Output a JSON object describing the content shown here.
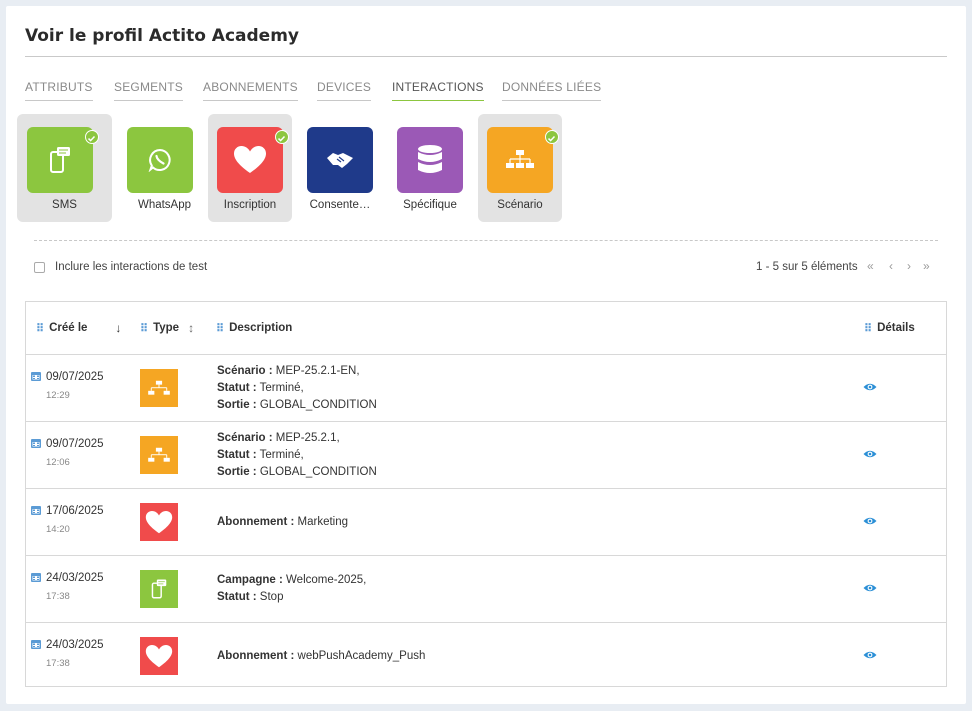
{
  "page": {
    "title": "Voir le profil Actito Academy"
  },
  "tabs": [
    {
      "label": "ATTRIBUTS",
      "active": false
    },
    {
      "label": "SEGMENTS",
      "active": false
    },
    {
      "label": "ABONNEMENTS",
      "active": false
    },
    {
      "label": "DEVICES",
      "active": false
    },
    {
      "label": "INTERACTIONS",
      "active": true
    },
    {
      "label": "DONNÉES LIÉES",
      "active": false
    }
  ],
  "interaction_types": [
    {
      "label": "SMS",
      "color": "#8cc63f",
      "icon": "phone-message-icon",
      "selected": true
    },
    {
      "label": "WhatsApp",
      "color": "#8cc63f",
      "icon": "whatsapp-icon",
      "selected": false
    },
    {
      "label": "Inscription",
      "color": "#f04b4b",
      "icon": "heart-icon",
      "selected": true
    },
    {
      "label": "Consente…",
      "color": "#1f3a8a",
      "icon": "handshake-icon",
      "selected": false
    },
    {
      "label": "Spécifique",
      "color": "#9b59b6",
      "icon": "database-icon",
      "selected": false
    },
    {
      "label": "Scénario",
      "color": "#f5a623",
      "icon": "scenario-flow-icon",
      "selected": true
    }
  ],
  "filters": {
    "include_test_label": "Inclure les interactions de test"
  },
  "pagination": {
    "summary": "1 - 5 sur 5 éléments"
  },
  "table": {
    "headers": {
      "created": "Créé le",
      "type": "Type",
      "description": "Description",
      "details": "Détails"
    },
    "rows": [
      {
        "date": "09/07/2025",
        "time": "12:29",
        "type_icon": "scenario-flow-icon",
        "type_color": "#f5a623",
        "lines": [
          {
            "k": "Scénario :",
            "v": " MEP-25.2.1-EN,"
          },
          {
            "k": "Statut :",
            "v": " Terminé,"
          },
          {
            "k": "Sortie :",
            "v": " GLOBAL_CONDITION"
          }
        ]
      },
      {
        "date": "09/07/2025",
        "time": "12:06",
        "type_icon": "scenario-flow-icon",
        "type_color": "#f5a623",
        "lines": [
          {
            "k": "Scénario :",
            "v": " MEP-25.2.1,"
          },
          {
            "k": "Statut :",
            "v": " Terminé,"
          },
          {
            "k": "Sortie :",
            "v": " GLOBAL_CONDITION"
          }
        ]
      },
      {
        "date": "17/06/2025",
        "time": "14:20",
        "type_icon": "heart-icon",
        "type_color": "#f04b4b",
        "lines": [
          {
            "k": "Abonnement :",
            "v": " Marketing"
          }
        ]
      },
      {
        "date": "24/03/2025",
        "time": "17:38",
        "type_icon": "phone-message-icon",
        "type_color": "#8cc63f",
        "lines": [
          {
            "k": "Campagne :",
            "v": " Welcome-2025,"
          },
          {
            "k": "Statut :",
            "v": " Stop"
          }
        ]
      },
      {
        "date": "24/03/2025",
        "time": "17:38",
        "type_icon": "heart-icon",
        "type_color": "#f04b4b",
        "lines": [
          {
            "k": "Abonnement :",
            "v": " webPushAcademy_Push"
          }
        ]
      }
    ]
  },
  "colors": {
    "accent": "#8cc63f",
    "link": "#2b8fd6",
    "grip": "#5b9bd5"
  }
}
